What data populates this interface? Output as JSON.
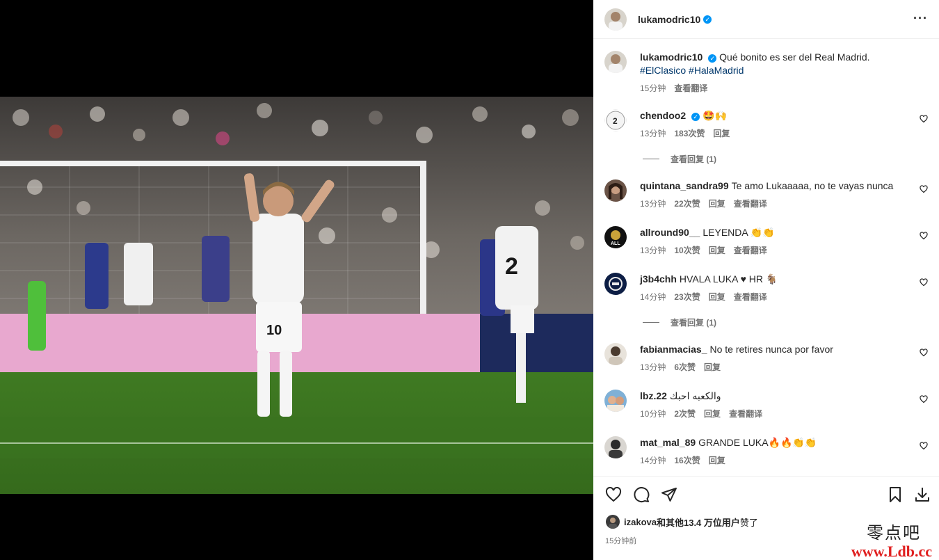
{
  "post": {
    "author": "lukamodric10",
    "caption": "Qué bonito es ser del Real Madrid.",
    "tags": [
      "#ElClasico",
      "#HalaMadrid"
    ],
    "time": "15分钟",
    "see_translation": "查看翻译"
  },
  "comments": [
    {
      "user": "chendoo2",
      "verified": true,
      "text": "🤩🙌",
      "time": "13分钟",
      "likes": "183次赞",
      "reply": "回复",
      "translate": "",
      "replies": "查看回复 (1)"
    },
    {
      "user": "quintana_sandra99",
      "verified": false,
      "text": "Te amo Lukaaaaa, no te vayas nunca",
      "time": "13分钟",
      "likes": "22次赞",
      "reply": "回复",
      "translate": "查看翻译",
      "replies": ""
    },
    {
      "user": "allround90__",
      "verified": false,
      "text": "LEYENDA 👏👏",
      "time": "13分钟",
      "likes": "10次赞",
      "reply": "回复",
      "translate": "查看翻译",
      "replies": ""
    },
    {
      "user": "j3b4chh",
      "verified": false,
      "text": "HVALA LUKA ♥ HR 🐐",
      "time": "14分钟",
      "likes": "23次赞",
      "reply": "回复",
      "translate": "查看翻译",
      "replies": "查看回复 (1)"
    },
    {
      "user": "fabianmacias_",
      "verified": false,
      "text": "No te retires nunca por favor",
      "time": "13分钟",
      "likes": "6次赞",
      "reply": "回复",
      "translate": "",
      "replies": ""
    },
    {
      "user": "lbz.22",
      "verified": false,
      "text": "والكعبه احبك",
      "time": "10分钟",
      "likes": "2次赞",
      "reply": "回复",
      "translate": "查看翻译",
      "replies": ""
    },
    {
      "user": "mat_mal_89",
      "verified": false,
      "text": "GRANDE LUKA🔥🔥👏👏",
      "time": "14分钟",
      "likes": "16次赞",
      "reply": "回复",
      "translate": "",
      "replies": ""
    }
  ],
  "likes_line": {
    "user": "izakova",
    "rest": "和其他13.4 万位用户",
    "end": "赞了"
  },
  "posted_ago": "15分钟前",
  "watermark": {
    "cn": "零点吧",
    "url": "www.Ldb.cc"
  },
  "icons": [
    "more-icon",
    "heart-icon",
    "comment-icon",
    "share-icon",
    "bookmark-icon",
    "download-icon"
  ]
}
